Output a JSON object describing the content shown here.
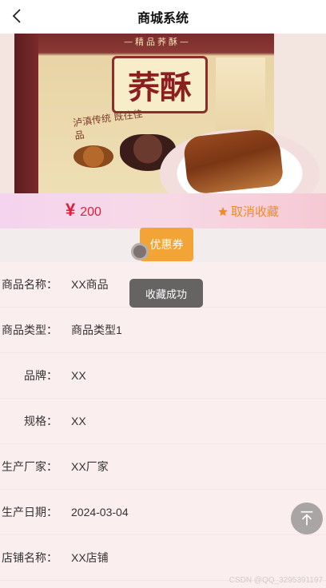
{
  "header": {
    "title": "商城系统",
    "back_icon": "chevron-left-icon"
  },
  "product_image": {
    "banner_text": "—精品荞酥—",
    "box_label": "荞酥",
    "box_script": "泸滇传统 既往佳品"
  },
  "price_bar": {
    "currency_symbol": "¥",
    "price": "200",
    "favorite_label": "取消收藏",
    "favorite_icon": "star-icon",
    "accent_price": "#e31c3b",
    "accent_fav": "#f08a2b"
  },
  "coupon": {
    "label": "优惠券"
  },
  "toast": {
    "message": "收藏成功"
  },
  "details": [
    {
      "label": "商品名称：",
      "value": "XX商品"
    },
    {
      "label": "商品类型：",
      "value": "商品类型1"
    },
    {
      "label": "品牌：",
      "value": "XX"
    },
    {
      "label": "规格：",
      "value": "XX"
    },
    {
      "label": "生产厂家：",
      "value": "XX厂家"
    },
    {
      "label": "生产日期：",
      "value": "2024-03-04"
    },
    {
      "label": "店铺名称：",
      "value": "XX店铺"
    }
  ],
  "back_to_top_icon": "arrow-up-to-top-icon",
  "watermark": "CSDN @QQ_3295391197"
}
